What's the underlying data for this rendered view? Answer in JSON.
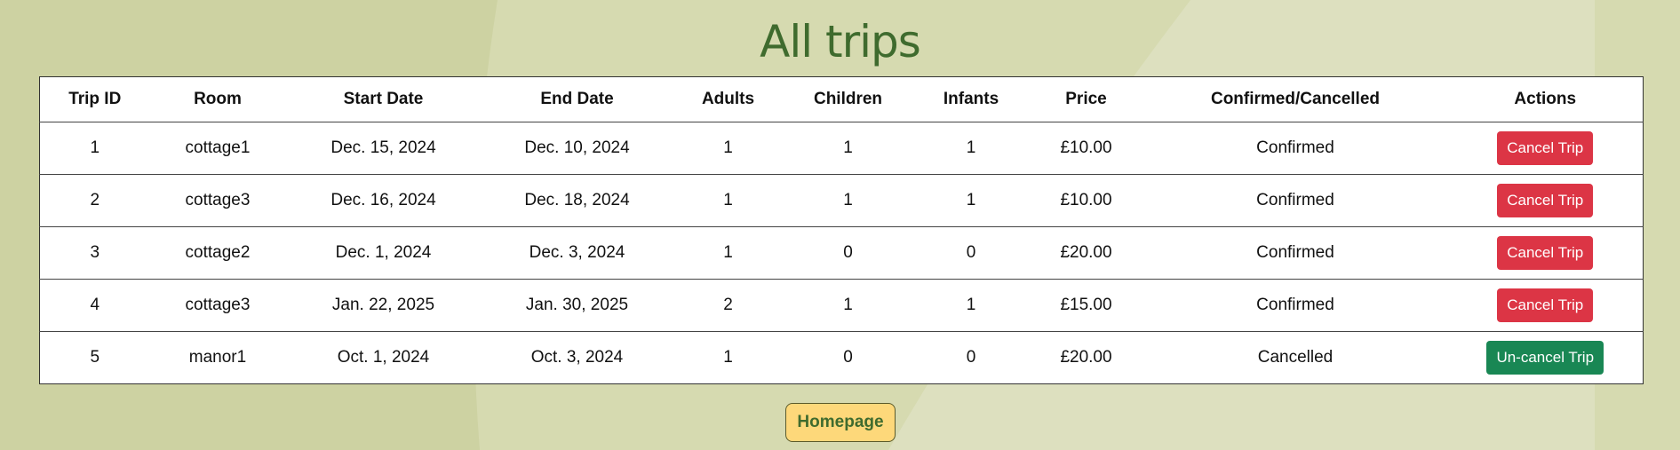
{
  "page": {
    "title": "All trips",
    "background_color": "#cdd2a2",
    "accent_color": "#3f6b2e"
  },
  "table": {
    "headers": [
      "Trip ID",
      "Room",
      "Start Date",
      "End Date",
      "Adults",
      "Children",
      "Infants",
      "Price",
      "Confirmed/Cancelled",
      "Actions"
    ],
    "rows": [
      {
        "id": "1",
        "room": "cottage1",
        "start": "Dec. 15, 2024",
        "end": "Dec. 10, 2024",
        "adults": "1",
        "children": "1",
        "infants": "1",
        "price": "£10.00",
        "status": "Confirmed",
        "action": "Cancel Trip"
      },
      {
        "id": "2",
        "room": "cottage3",
        "start": "Dec. 16, 2024",
        "end": "Dec. 18, 2024",
        "adults": "1",
        "children": "1",
        "infants": "1",
        "price": "£10.00",
        "status": "Confirmed",
        "action": "Cancel Trip"
      },
      {
        "id": "3",
        "room": "cottage2",
        "start": "Dec. 1, 2024",
        "end": "Dec. 3, 2024",
        "adults": "1",
        "children": "0",
        "infants": "0",
        "price": "£20.00",
        "status": "Confirmed",
        "action": "Cancel Trip"
      },
      {
        "id": "4",
        "room": "cottage3",
        "start": "Jan. 22, 2025",
        "end": "Jan. 30, 2025",
        "adults": "2",
        "children": "1",
        "infants": "1",
        "price": "£15.00",
        "status": "Confirmed",
        "action": "Cancel Trip"
      },
      {
        "id": "5",
        "room": "manor1",
        "start": "Oct. 1, 2024",
        "end": "Oct. 3, 2024",
        "adults": "1",
        "children": "0",
        "infants": "0",
        "price": "£20.00",
        "status": "Cancelled",
        "action": "Un-cancel Trip"
      }
    ]
  },
  "colors": {
    "cancel_button": "#dc3545",
    "uncancel_button": "#198754",
    "home_button": "#fdd87a"
  },
  "footer": {
    "home_label": "Homepage"
  }
}
